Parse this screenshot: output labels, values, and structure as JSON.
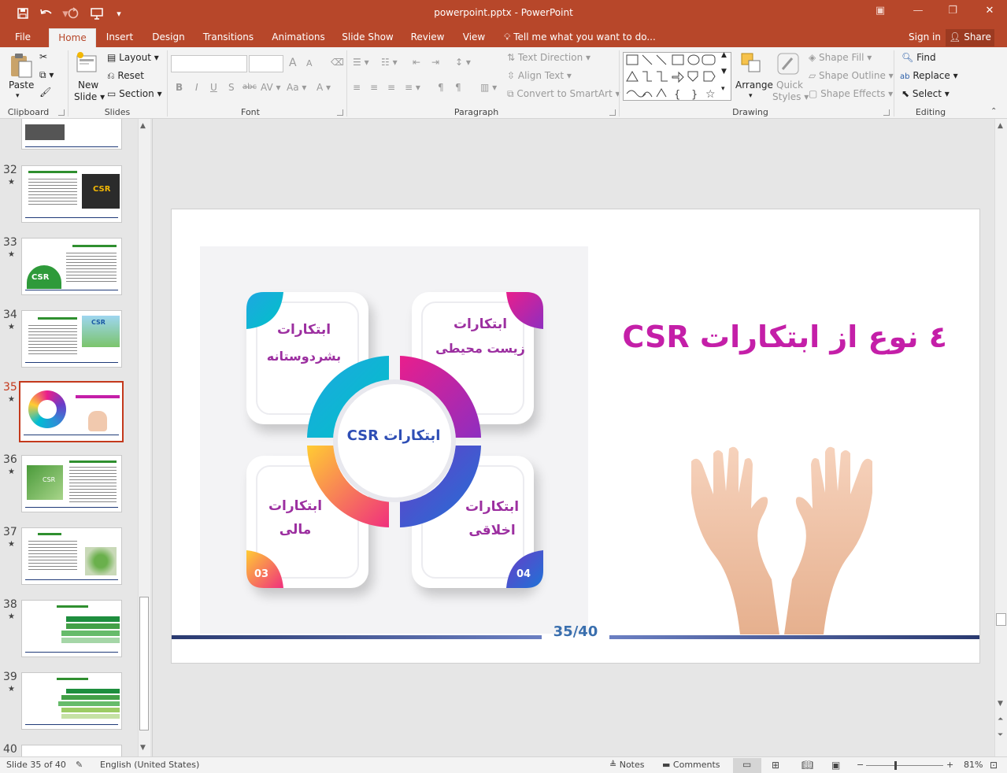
{
  "window": {
    "title": "powerpoint.pptx - PowerPoint",
    "quick_access": [
      "save-icon",
      "undo-icon",
      "redo-icon",
      "present-icon",
      "customize-icon"
    ],
    "buttons": [
      "ribbon-display-icon",
      "minimize-icon",
      "restore-icon",
      "close-icon"
    ]
  },
  "menu": {
    "tabs": [
      "File",
      "Home",
      "Insert",
      "Design",
      "Transitions",
      "Animations",
      "Slide Show",
      "Review",
      "View"
    ],
    "active": "Home",
    "tell_me": "Tell me what you want to do...",
    "sign_in": "Sign in",
    "share": "Share"
  },
  "ribbon": {
    "clipboard": {
      "label": "Clipboard",
      "paste": "Paste"
    },
    "slides": {
      "label": "Slides",
      "new_slide_line1": "New",
      "new_slide_line2": "Slide",
      "layout": "Layout",
      "reset": "Reset",
      "section": "Section"
    },
    "font": {
      "label": "Font",
      "bold": "B",
      "italic": "I",
      "underline": "U",
      "shadow": "S",
      "strike": "abc",
      "spacing": "AV",
      "case": "Aa",
      "grow": "A",
      "shrink": "A"
    },
    "paragraph": {
      "label": "Paragraph",
      "text_direction": "Text Direction",
      "align_text": "Align Text",
      "convert_smartart": "Convert to SmartArt"
    },
    "drawing": {
      "label": "Drawing",
      "arrange": "Arrange",
      "quick_styles_1": "Quick",
      "quick_styles_2": "Styles",
      "shape_fill": "Shape Fill",
      "shape_outline": "Shape Outline",
      "shape_effects": "Shape Effects"
    },
    "editing": {
      "label": "Editing",
      "find": "Find",
      "replace": "Replace",
      "select": "Select"
    }
  },
  "thumbnails": [
    {
      "num": "32",
      "star": "★"
    },
    {
      "num": "33",
      "star": "★"
    },
    {
      "num": "34",
      "star": "★"
    },
    {
      "num": "35",
      "star": "★",
      "selected": true
    },
    {
      "num": "36",
      "star": "★"
    },
    {
      "num": "37",
      "star": "★"
    },
    {
      "num": "38",
      "star": "★"
    },
    {
      "num": "39",
      "star": "★"
    },
    {
      "num": "40",
      "star": ""
    }
  ],
  "slide": {
    "title": "٤ نوع از ابتکارات CSR",
    "center": "ابتکارات CSR",
    "petals": [
      {
        "line1": "ابتکارات",
        "line2": "بشردوستانه"
      },
      {
        "line1": "ابتکارات",
        "line2": "زیست محیطی"
      },
      {
        "line1": "ابتکارات",
        "line2": "مالی",
        "num": "03"
      },
      {
        "line1": "ابتکارات",
        "line2": "اخلاقی",
        "num": "04"
      }
    ],
    "page": "35/40"
  },
  "status": {
    "slide_of": "Slide 35 of 40",
    "language": "English (United States)",
    "notes": "Notes",
    "comments": "Comments",
    "zoom": "81%"
  },
  "colors": {
    "brand": "#b7472a",
    "title_magenta": "#c41fa8",
    "petal_text": "#9c2fa0",
    "center_blue": "#2e4eb5"
  }
}
